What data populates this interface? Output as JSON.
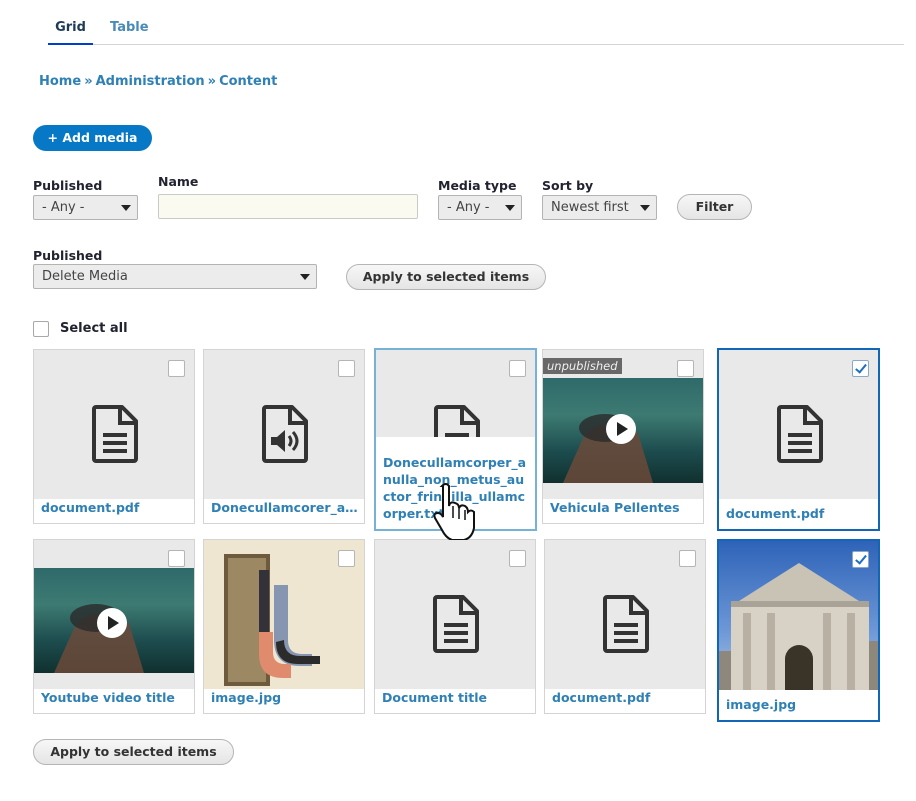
{
  "tabs": [
    {
      "label": "Grid"
    },
    {
      "label": "Table"
    }
  ],
  "breadcrumb": [
    {
      "label": "Home"
    },
    {
      "label": "Administration"
    },
    {
      "label": "Content"
    }
  ],
  "add_media_label": "+ Add media",
  "filters": {
    "published_label": "Published",
    "published_value": "- Any -",
    "name_label": "Name",
    "name_value": "",
    "media_type_label": "Media type",
    "media_type_value": "- Any -",
    "sort_by_label": "Sort by",
    "sort_by_value": "Newest first",
    "filter_button": "Filter"
  },
  "bulk": {
    "action_label": "Published",
    "action_value": "Delete Media",
    "apply_top": "Apply to selected items",
    "apply_bottom": "Apply to selected items"
  },
  "select_all_label": "Select all",
  "media": [
    {
      "caption": "document.pdf",
      "type": "document",
      "checked": false
    },
    {
      "caption": "Donecullamcorer_an...",
      "type": "audio",
      "checked": false
    },
    {
      "caption": "Donecullamcorper_anulla_non_metus_auctor_fringilla_ullamcorper.txt",
      "type": "document",
      "checked": false
    },
    {
      "caption": "Vehicula Pellentes",
      "type": "video",
      "badge": "unpublished",
      "checked": false
    },
    {
      "caption": "document.pdf",
      "type": "document",
      "checked": true
    },
    {
      "caption": "Youtube video title",
      "type": "video",
      "checked": false
    },
    {
      "caption": "image.jpg",
      "type": "image",
      "checked": false
    },
    {
      "caption": "Document title",
      "type": "document",
      "checked": false
    },
    {
      "caption": "document.pdf",
      "type": "document",
      "checked": false
    },
    {
      "caption": "image.jpg",
      "type": "image",
      "checked": true
    }
  ],
  "colors": {
    "primary": "#0678c6",
    "link": "#2f80b5",
    "selected_border": "#1266b8"
  }
}
